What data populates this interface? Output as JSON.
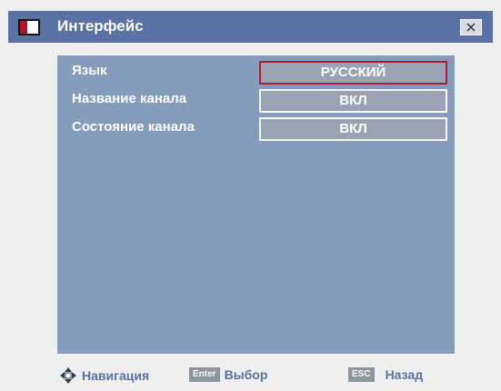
{
  "window": {
    "title": "Интерфейс"
  },
  "settings": [
    {
      "label": "Язык",
      "value": "РУССКИЙ",
      "selected": true
    },
    {
      "label": "Название канала",
      "value": "ВКЛ",
      "selected": false
    },
    {
      "label": "Состояние канала",
      "value": "ВКЛ",
      "selected": false
    }
  ],
  "footer": {
    "navigation_label": "Навигация",
    "enter_key": "Enter",
    "enter_label": "Выбор",
    "esc_key": "ESC",
    "esc_label": "Назад"
  },
  "colors": {
    "titlebar": "#5a71a3",
    "panel": "#859cbd",
    "selected_border": "#a0203a",
    "hint_text": "#5a72a5"
  }
}
